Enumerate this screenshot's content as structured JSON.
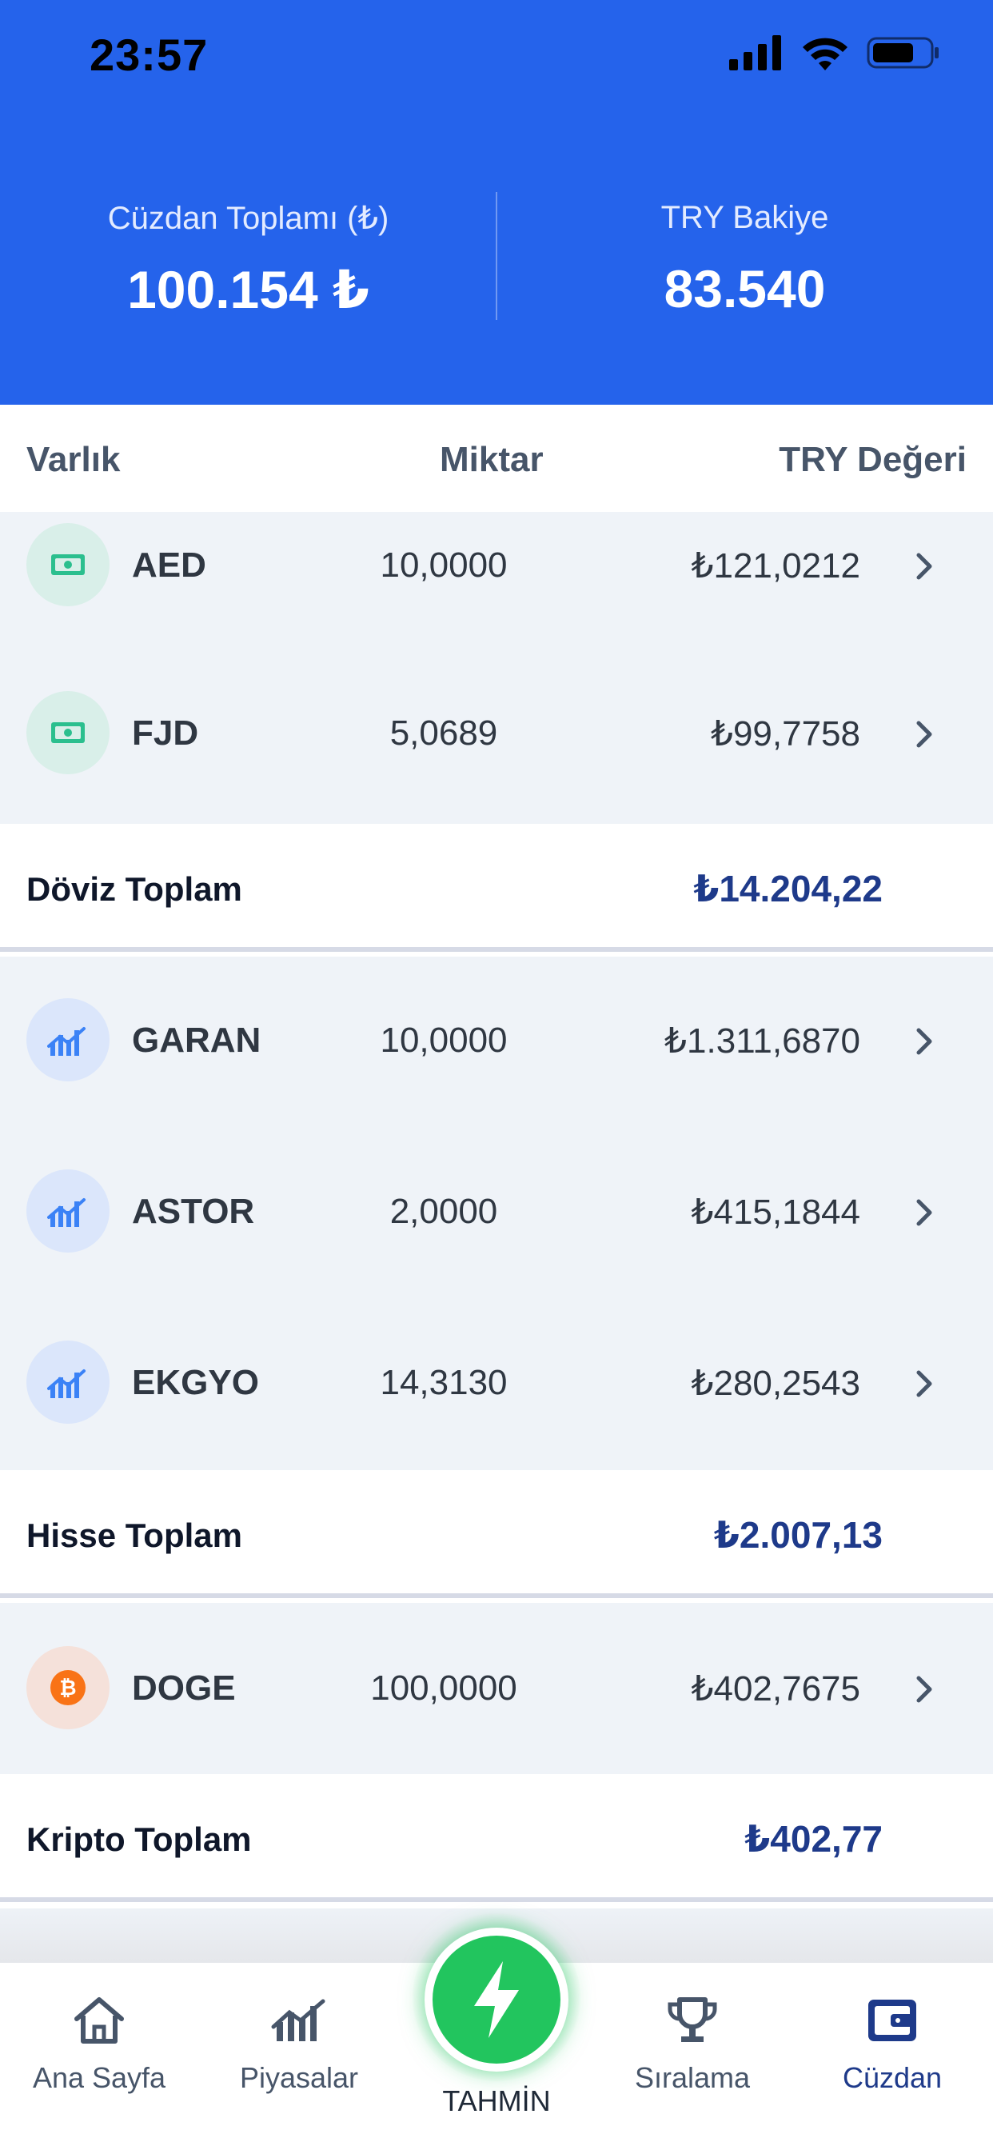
{
  "status_bar": {
    "time": "23:57"
  },
  "summary": {
    "wallet_total_label": "Cüzdan Toplamı (₺)",
    "wallet_total_value": "100.154 ₺",
    "try_balance_label": "TRY Bakiye",
    "try_balance_value": "83.540"
  },
  "table_header": {
    "asset": "Varlık",
    "amount": "Miktar",
    "value": "TRY Değeri"
  },
  "currency": {
    "rows": [
      {
        "symbol": "AED",
        "amount": "10,0000",
        "value": "₺121,0212"
      },
      {
        "symbol": "FJD",
        "amount": "5,0689",
        "value": "₺99,7758"
      }
    ],
    "total_label": "Döviz Toplam",
    "total_value": "₺14.204,22"
  },
  "stocks": {
    "rows": [
      {
        "symbol": "GARAN",
        "amount": "10,0000",
        "value": "₺1.311,6870"
      },
      {
        "symbol": "ASTOR",
        "amount": "2,0000",
        "value": "₺415,1844"
      },
      {
        "symbol": "EKGYO",
        "amount": "14,3130",
        "value": "₺280,2543"
      }
    ],
    "total_label": "Hisse Toplam",
    "total_value": "₺2.007,13"
  },
  "crypto": {
    "rows": [
      {
        "symbol": "DOGE",
        "amount": "100,0000",
        "value": "₺402,7675"
      }
    ],
    "total_label": "Kripto Toplam",
    "total_value": "₺402,77"
  },
  "nav": {
    "home": "Ana Sayfa",
    "markets": "Piyasalar",
    "predict": "TAHMİN",
    "ranking": "Sıralama",
    "wallet": "Cüzdan"
  },
  "colors": {
    "header_bg": "#2563eb",
    "row_bg": "#eff3f8",
    "total_value": "#1e3a8a",
    "fab": "#22c55e"
  }
}
